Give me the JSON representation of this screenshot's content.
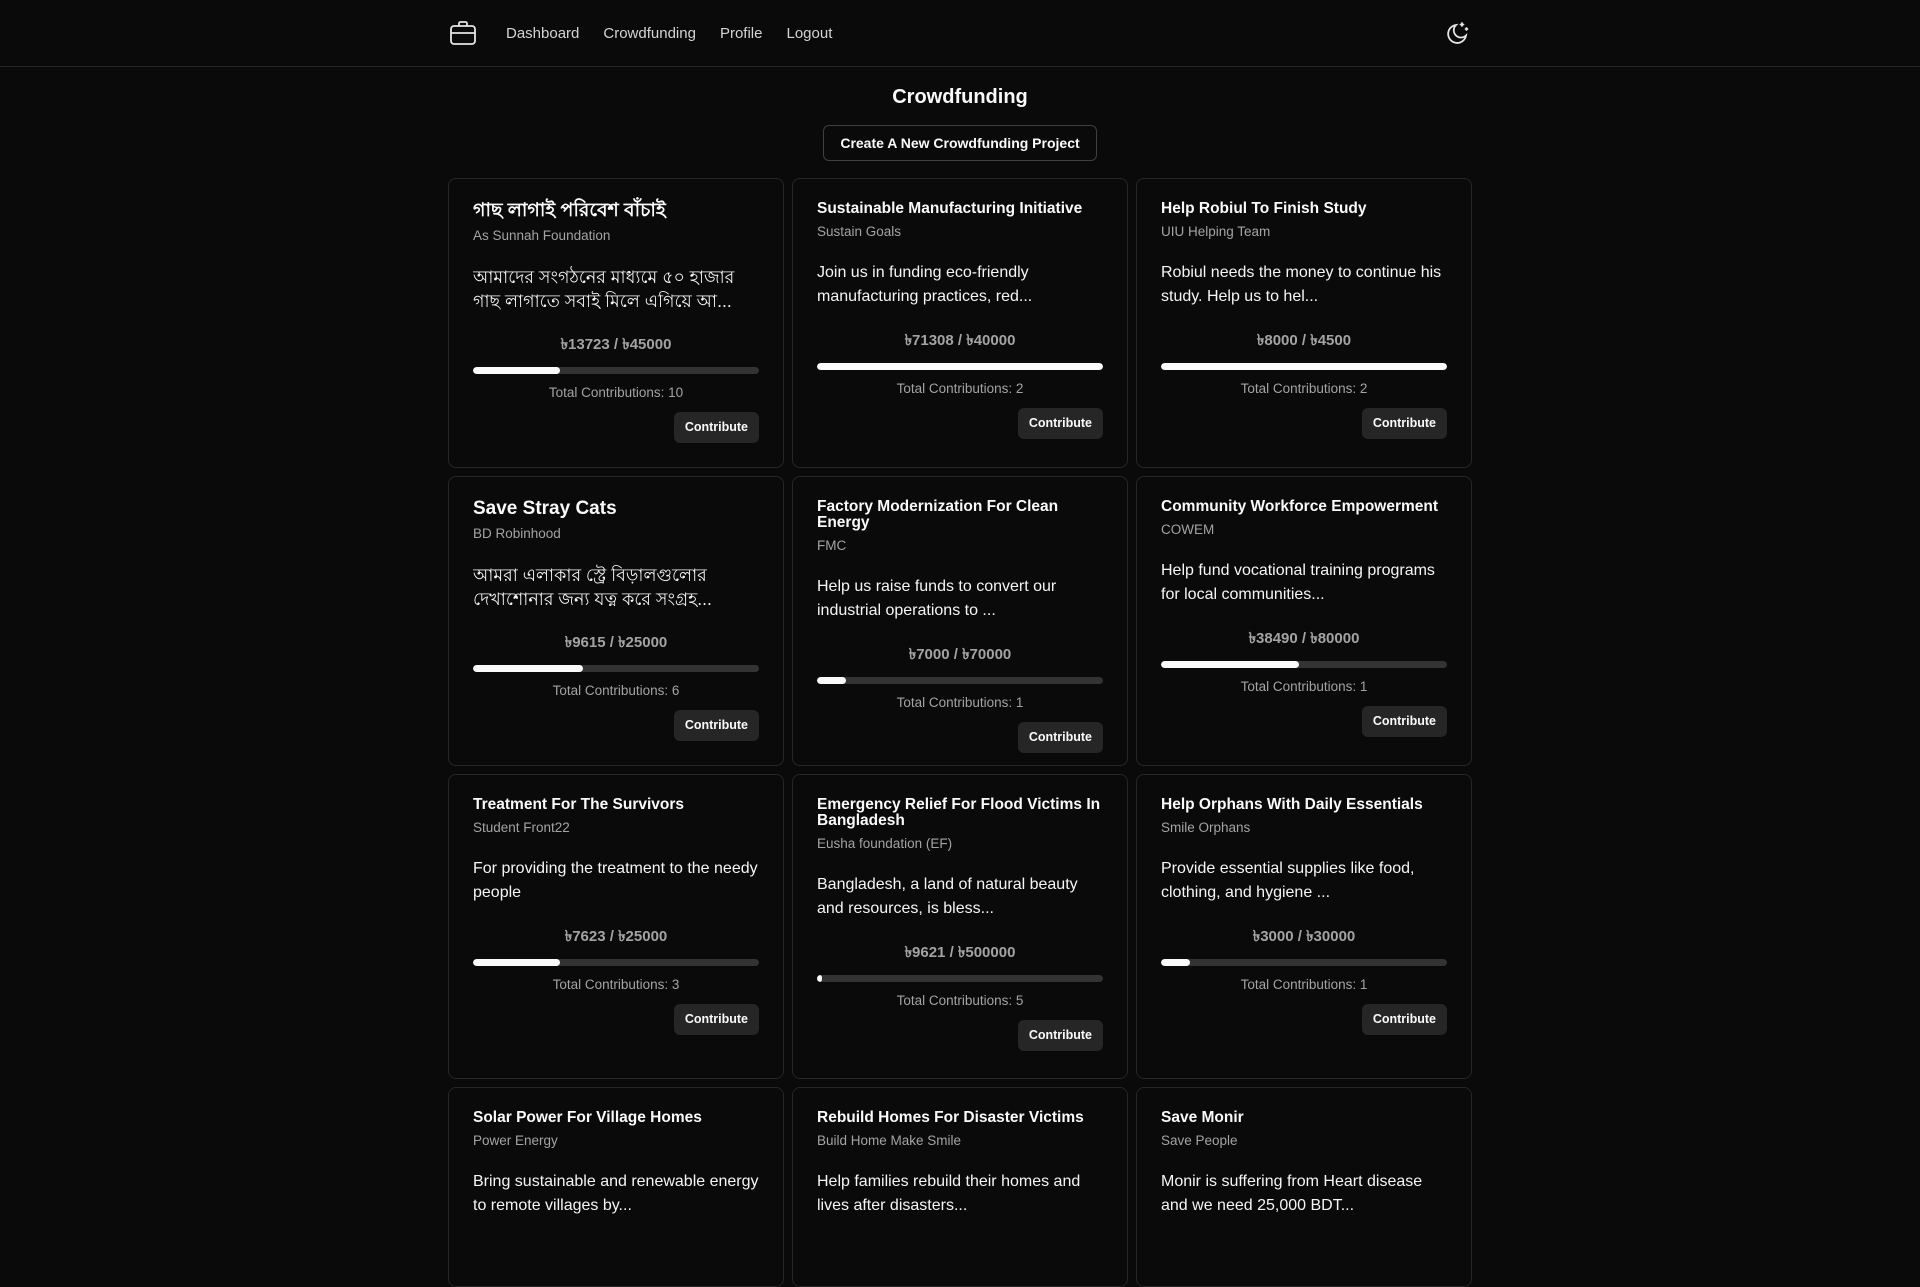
{
  "nav": {
    "logo_icon": "briefcase-icon",
    "links": [
      "Dashboard",
      "Crowdfunding",
      "Profile",
      "Logout"
    ],
    "theme_icon": "moon-stars-icon"
  },
  "page": {
    "title": "Crowdfunding",
    "create_button": "Create A New Crowdfunding Project"
  },
  "cards": [
    {
      "title": "গাছ লাগাই পরিবেশ বাঁচাই",
      "org": "As Sunnah Foundation",
      "desc": "আমাদের সংগঠনের মাধ্যমে ৫০ হাজার গাছ লাগাতে সবাই মিলে এগিয়ে আ...",
      "amount": "৳13723 / ৳45000",
      "progress": 0.305,
      "contributions": "Total Contributions: 10",
      "button": "Contribute",
      "bangla": true
    },
    {
      "title": "Sustainable Manufacturing Initiative",
      "org": "Sustain Goals",
      "desc": "Join us in funding eco-friendly manufacturing practices, red...",
      "amount": "৳71308 / ৳40000",
      "progress": 1.0,
      "contributions": "Total Contributions: 2",
      "button": "Contribute",
      "bangla": false
    },
    {
      "title": "Help Robiul To Finish Study",
      "org": "UIU Helping Team",
      "desc": "Robiul needs the money to continue his study. Help us to hel...",
      "amount": "৳8000 / ৳4500",
      "progress": 1.0,
      "contributions": "Total Contributions: 2",
      "button": "Contribute",
      "bangla": false
    },
    {
      "title": "Save Stray Cats",
      "org": "BD Robinhood",
      "desc": "আমরা এলাকার স্ট্রে বিড়ালগুলোর দেখাশোনার জন্য যত্ন করে সংগ্রহ...",
      "amount": "৳9615 / ৳25000",
      "progress": 0.385,
      "contributions": "Total Contributions: 6",
      "button": "Contribute",
      "bangla": true
    },
    {
      "title": "Factory Modernization For Clean Energy",
      "org": "FMC",
      "desc": "Help us raise funds to convert our industrial operations to ...",
      "amount": "৳7000 / ৳70000",
      "progress": 0.1,
      "contributions": "Total Contributions: 1",
      "button": "Contribute",
      "bangla": false
    },
    {
      "title": "Community Workforce Empowerment",
      "org": "COWEM",
      "desc": "Help fund vocational training programs for local communities...",
      "amount": "৳38490 / ৳80000",
      "progress": 0.481,
      "contributions": "Total Contributions: 1",
      "button": "Contribute",
      "bangla": false
    },
    {
      "title": "Treatment For The Survivors",
      "org": "Student Front22",
      "desc": "For providing the treatment to the needy people",
      "amount": "৳7623 / ৳25000",
      "progress": 0.305,
      "contributions": "Total Contributions: 3",
      "button": "Contribute",
      "bangla": false
    },
    {
      "title": "Emergency Relief For Flood Victims In Bangladesh",
      "org": "Eusha foundation (EF)",
      "desc": "Bangladesh, a land of natural beauty and resources, is bless...",
      "amount": "৳9621 / ৳500000",
      "progress": 0.019,
      "contributions": "Total Contributions: 5",
      "button": "Contribute",
      "bangla": false
    },
    {
      "title": "Help Orphans With Daily Essentials",
      "org": "Smile Orphans",
      "desc": "Provide essential supplies like food, clothing, and hygiene ...",
      "amount": "৳3000 / ৳30000",
      "progress": 0.1,
      "contributions": "Total Contributions: 1",
      "button": "Contribute",
      "bangla": false
    },
    {
      "title": "Solar Power For Village Homes",
      "org": "Power Energy",
      "desc": "Bring sustainable and renewable energy to remote villages by...",
      "amount": "",
      "progress": null,
      "contributions": "",
      "button": "",
      "bangla": false
    },
    {
      "title": "Rebuild Homes For Disaster Victims",
      "org": "Build Home Make Smile",
      "desc": "Help families rebuild their homes and lives after disasters...",
      "amount": "",
      "progress": null,
      "contributions": "",
      "button": "",
      "bangla": false
    },
    {
      "title": "Save Monir",
      "org": "Save People",
      "desc": "Monir is suffering from Heart disease and we need 25,000 BDT...",
      "amount": "",
      "progress": null,
      "contributions": "",
      "button": "",
      "bangla": false
    }
  ]
}
